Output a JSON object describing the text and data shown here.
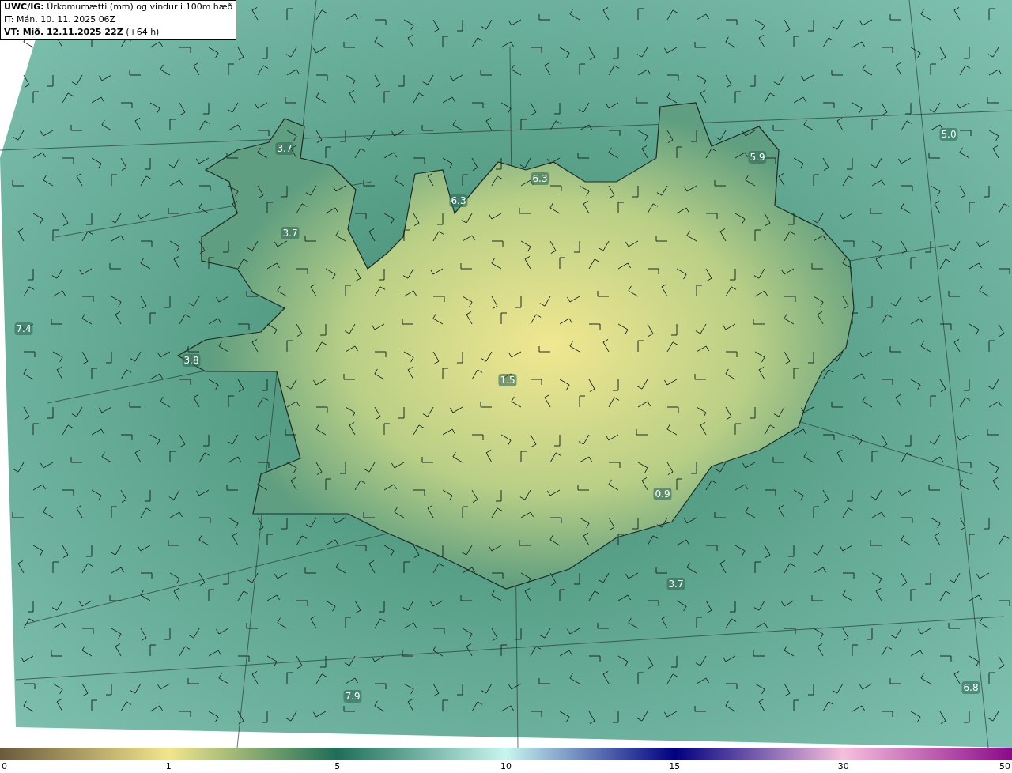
{
  "header": {
    "lines": [
      "**UWC/IG:** Úrkomumætti (mm) og vindur i 100m hæð",
      "IT: Mán. 10. 11. 2025 06Z",
      "**VT: Mið. 12.11.2025 22Z** (+64 h)"
    ]
  },
  "map_labels": [
    "3.7",
    "3.7",
    "6.3",
    "6.3",
    "5.9",
    "5.0",
    "7.4",
    "3.8",
    "1.5",
    "0.9",
    "3.7",
    "6.8",
    "7.9"
  ],
  "colorbar": {
    "ticks": [
      "0",
      "1",
      "5",
      "10",
      "15",
      "30",
      "50"
    ]
  }
}
